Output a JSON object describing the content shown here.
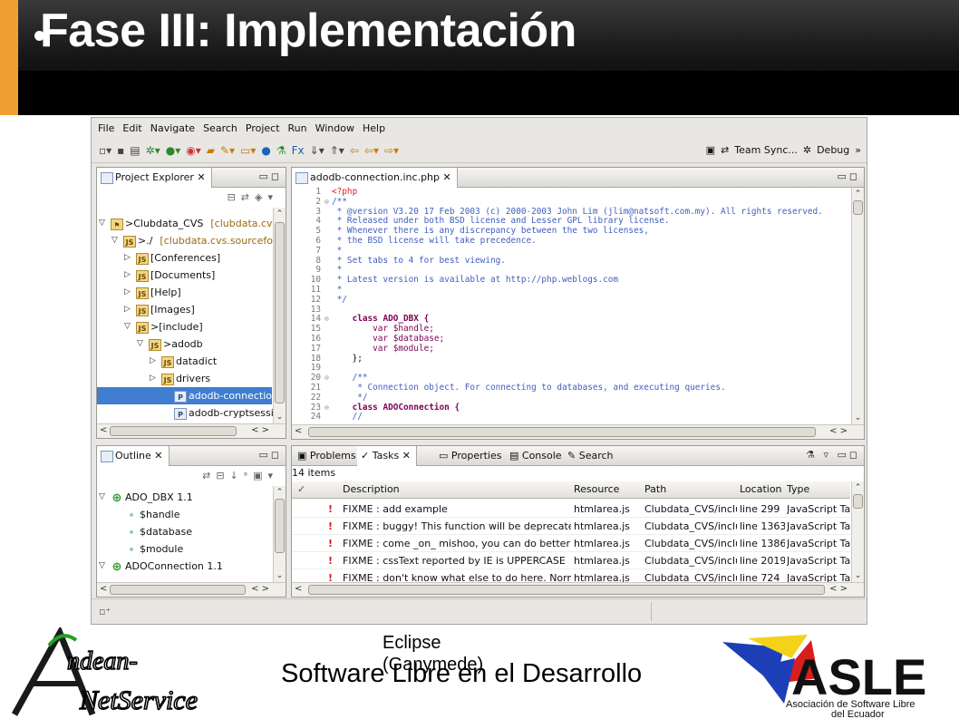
{
  "slide": {
    "title": "Fase III: Implementación",
    "caption": "Eclipse (Ganymede)",
    "footer": "Software Libre en el Desarrollo",
    "logo_left_text": [
      "ndean-",
      "NetService"
    ],
    "logo_right_text": "ASLE",
    "logo_right_sub": [
      "Asociación de Software Libre",
      "del Ecuador"
    ],
    "colors": {
      "header_accent": "#f0a030",
      "selection": "#3f7ed0"
    }
  },
  "eclipse": {
    "menu": [
      "File",
      "Edit",
      "Navigate",
      "Search",
      "Project",
      "Run",
      "Window",
      "Help"
    ],
    "perspectives": [
      "Team Sync...",
      "Debug"
    ],
    "project_explorer": {
      "title": "Project Explorer",
      "items": [
        {
          "label": ">Clubdata_CVS",
          "extra": "[clubdata.cvs",
          "indent": 0,
          "arrow": "▽",
          "icon": "project-icon"
        },
        {
          "label": ">./",
          "extra": "[clubdata.cvs.sourcefo",
          "indent": 1,
          "arrow": "▽",
          "icon": "package-icon"
        },
        {
          "label": "[Conferences]",
          "extra": "",
          "indent": 2,
          "arrow": "▷",
          "icon": "package-icon"
        },
        {
          "label": "[Documents]",
          "extra": "",
          "indent": 2,
          "arrow": "▷",
          "icon": "package-icon"
        },
        {
          "label": "[Help]",
          "extra": "",
          "indent": 2,
          "arrow": "▷",
          "icon": "package-icon"
        },
        {
          "label": "[Images]",
          "extra": "",
          "indent": 2,
          "arrow": "▷",
          "icon": "package-icon"
        },
        {
          "label": ">[include]",
          "extra": "",
          "indent": 2,
          "arrow": "▽",
          "icon": "package-icon"
        },
        {
          "label": ">adodb",
          "extra": "",
          "indent": 3,
          "arrow": "▽",
          "icon": "package-icon"
        },
        {
          "label": "datadict",
          "extra": "",
          "indent": 4,
          "arrow": "▷",
          "icon": "package-icon"
        },
        {
          "label": "drivers",
          "extra": "",
          "indent": 4,
          "arrow": "▷",
          "icon": "package-icon"
        },
        {
          "label": "adodb-connection.in",
          "extra": "",
          "indent": 5,
          "arrow": "",
          "icon": "php-file-icon",
          "selected": true
        },
        {
          "label": "adodb-cryptsession.",
          "extra": "",
          "indent": 5,
          "arrow": "",
          "icon": "php-file-icon"
        }
      ]
    },
    "outline": {
      "title": "Outline",
      "items": [
        {
          "label": "ADO_DBX  1.1",
          "indent": 0,
          "arrow": "▽",
          "icon": "class-icon"
        },
        {
          "label": "$handle",
          "indent": 1,
          "arrow": "",
          "icon": "field-icon"
        },
        {
          "label": "$database",
          "indent": 1,
          "arrow": "",
          "icon": "field-icon"
        },
        {
          "label": "$module",
          "indent": 1,
          "arrow": "",
          "icon": "field-icon"
        },
        {
          "label": "ADOConnection  1.1",
          "indent": 0,
          "arrow": "▽",
          "icon": "class-icon"
        }
      ]
    },
    "editor": {
      "tab": "adodb-connection.inc.php",
      "lines": [
        {
          "n": "1",
          "f": "",
          "t": "<?php",
          "c": "tg"
        },
        {
          "n": "2",
          "f": "⊖",
          "t": "/**",
          "c": "cm"
        },
        {
          "n": "3",
          "f": "",
          "t": " * @version V3.20 17 Feb 2003 (c) 2000-2003 John Lim (jlim@natsoft.com.my). All rights reserved.",
          "c": "cm"
        },
        {
          "n": "4",
          "f": "",
          "t": " * Released under both BSD license and Lesser GPL library license.",
          "c": "cm"
        },
        {
          "n": "5",
          "f": "",
          "t": " * Whenever there is any discrepancy between the two licenses,",
          "c": "cm"
        },
        {
          "n": "6",
          "f": "",
          "t": " * the BSD license will take precedence.",
          "c": "cm"
        },
        {
          "n": "7",
          "f": "",
          "t": " *",
          "c": "cm"
        },
        {
          "n": "8",
          "f": "",
          "t": " * Set tabs to 4 for best viewing.",
          "c": "cm"
        },
        {
          "n": "9",
          "f": "",
          "t": " *",
          "c": "cm"
        },
        {
          "n": "10",
          "f": "",
          "t": " * Latest version is available at http://php.weblogs.com",
          "c": "cm"
        },
        {
          "n": "11",
          "f": "",
          "t": " *",
          "c": "cm"
        },
        {
          "n": "12",
          "f": "",
          "t": " */",
          "c": "cm"
        },
        {
          "n": "13",
          "f": "",
          "t": "",
          "c": "tx"
        },
        {
          "n": "14",
          "f": "⊖",
          "t": "    class ADO_DBX {",
          "c": "kw"
        },
        {
          "n": "15",
          "f": "",
          "t": "        var $handle;",
          "c": "vr"
        },
        {
          "n": "16",
          "f": "",
          "t": "        var $database;",
          "c": "vr"
        },
        {
          "n": "17",
          "f": "",
          "t": "        var $module;",
          "c": "vr"
        },
        {
          "n": "18",
          "f": "",
          "t": "    };",
          "c": "tx"
        },
        {
          "n": "19",
          "f": "",
          "t": "",
          "c": "tx"
        },
        {
          "n": "20",
          "f": "⊖",
          "t": "    /**",
          "c": "cm"
        },
        {
          "n": "21",
          "f": "",
          "t": "     * Connection object. For connecting to databases, and executing queries.",
          "c": "cm"
        },
        {
          "n": "22",
          "f": "",
          "t": "     */",
          "c": "cm"
        },
        {
          "n": "23",
          "f": "⊖",
          "t": "    class ADOConnection {",
          "c": "kw"
        },
        {
          "n": "24",
          "f": "",
          "t": "    //",
          "c": "cm"
        }
      ]
    },
    "bottom_tabs": [
      "Problems",
      "Tasks",
      "Properties",
      "Console",
      "Search"
    ],
    "tasks": {
      "count": "14 items",
      "columns": [
        "Description",
        "Resource",
        "Path",
        "Location",
        "Type"
      ],
      "rows": [
        {
          "desc": "FIXME : add example",
          "res": "htmlarea.js",
          "path": "Clubdata_CVS/inclu",
          "loc": "line 299",
          "type": "JavaScript Tas"
        },
        {
          "desc": "FIXME : buggy!  This function will be deprecated",
          "res": "htmlarea.js",
          "path": "Clubdata_CVS/inclu",
          "loc": "line 1363",
          "type": "JavaScript Tas"
        },
        {
          "desc": "FIXME : come _on_ mishoo, you can do better th",
          "res": "htmlarea.js",
          "path": "Clubdata_CVS/inclu",
          "loc": "line 1386",
          "type": "JavaScript Tas"
        },
        {
          "desc": "FIXME : cssText reported by IE is UPPERCASE",
          "res": "htmlarea.js",
          "path": "Clubdata_CVS/inclu",
          "loc": "line 2019",
          "type": "JavaScript Tas"
        },
        {
          "desc": "FIXME : don't know what else to do here.  Norm:",
          "res": "htmlarea.js",
          "path": "Clubdata_CVS/inclu",
          "loc": "line 724",
          "type": "JavaScript Tas"
        }
      ]
    }
  }
}
